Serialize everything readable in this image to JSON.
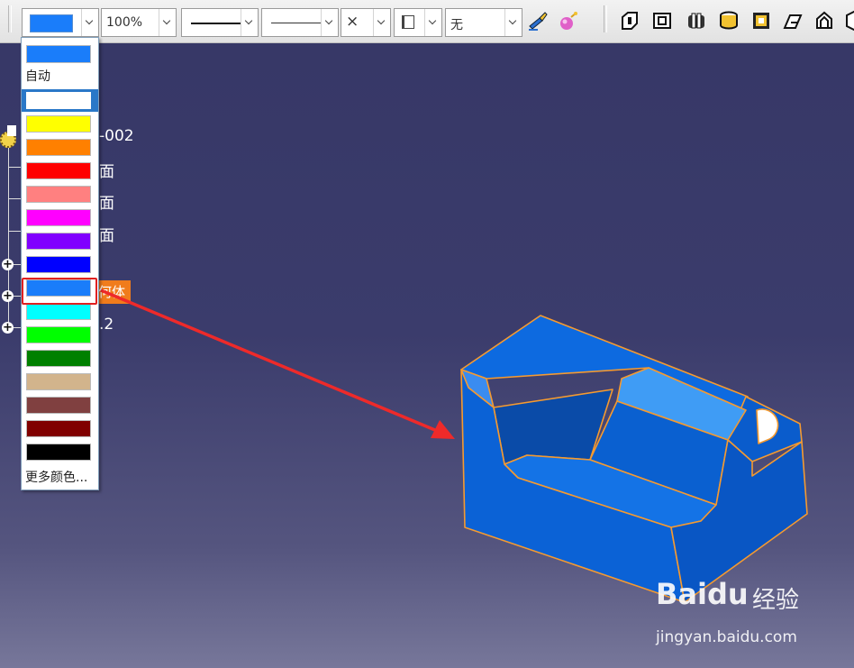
{
  "toolbar": {
    "color_value": "#1a7dfa",
    "transparency_value": "100%",
    "line_thickness": "solid-thick",
    "line_type": "solid-thin",
    "point_symbol": "×",
    "layer_icon": "layer-icon",
    "layer_value": "无",
    "icons": [
      "painter-brush-icon",
      "material-sphere-icon",
      "extrude-pad-icon",
      "pocket-icon",
      "shaft-icon",
      "hole-cylinder-icon",
      "shell-icon",
      "draft-icon",
      "rib-icon",
      "solid-icon"
    ]
  },
  "color_dropdown": {
    "top_swatch": "#1a7dfa",
    "auto_label": "自动",
    "white_swatch": "#ffffff",
    "swatches": [
      "#ffff00",
      "#ff8000",
      "#ff0000",
      "#ff8080",
      "#ff00ff",
      "#8000ff",
      "#0000ff",
      "#1a7dfa",
      "#00ffff",
      "#00ff00",
      "#008000",
      "#d2b48c",
      "#804040",
      "#800000",
      "#000000"
    ],
    "highlighted_index": 7,
    "more_colors_label": "更多颜色..."
  },
  "tree": {
    "root_suffix": "-002",
    "item_a": "面",
    "item_b": "面",
    "item_c": "面",
    "highlighted_tag": "何体",
    "item_d": ".2"
  },
  "watermark": {
    "logo": "Baidu",
    "label": "经验",
    "url": "jingyan.baidu.com"
  },
  "colors": {
    "background_top": "#363766",
    "background_bottom": "#77779a",
    "model_fill": "#0a62d6",
    "model_edge": "#f59a30",
    "arrow": "#ee2a2a"
  }
}
